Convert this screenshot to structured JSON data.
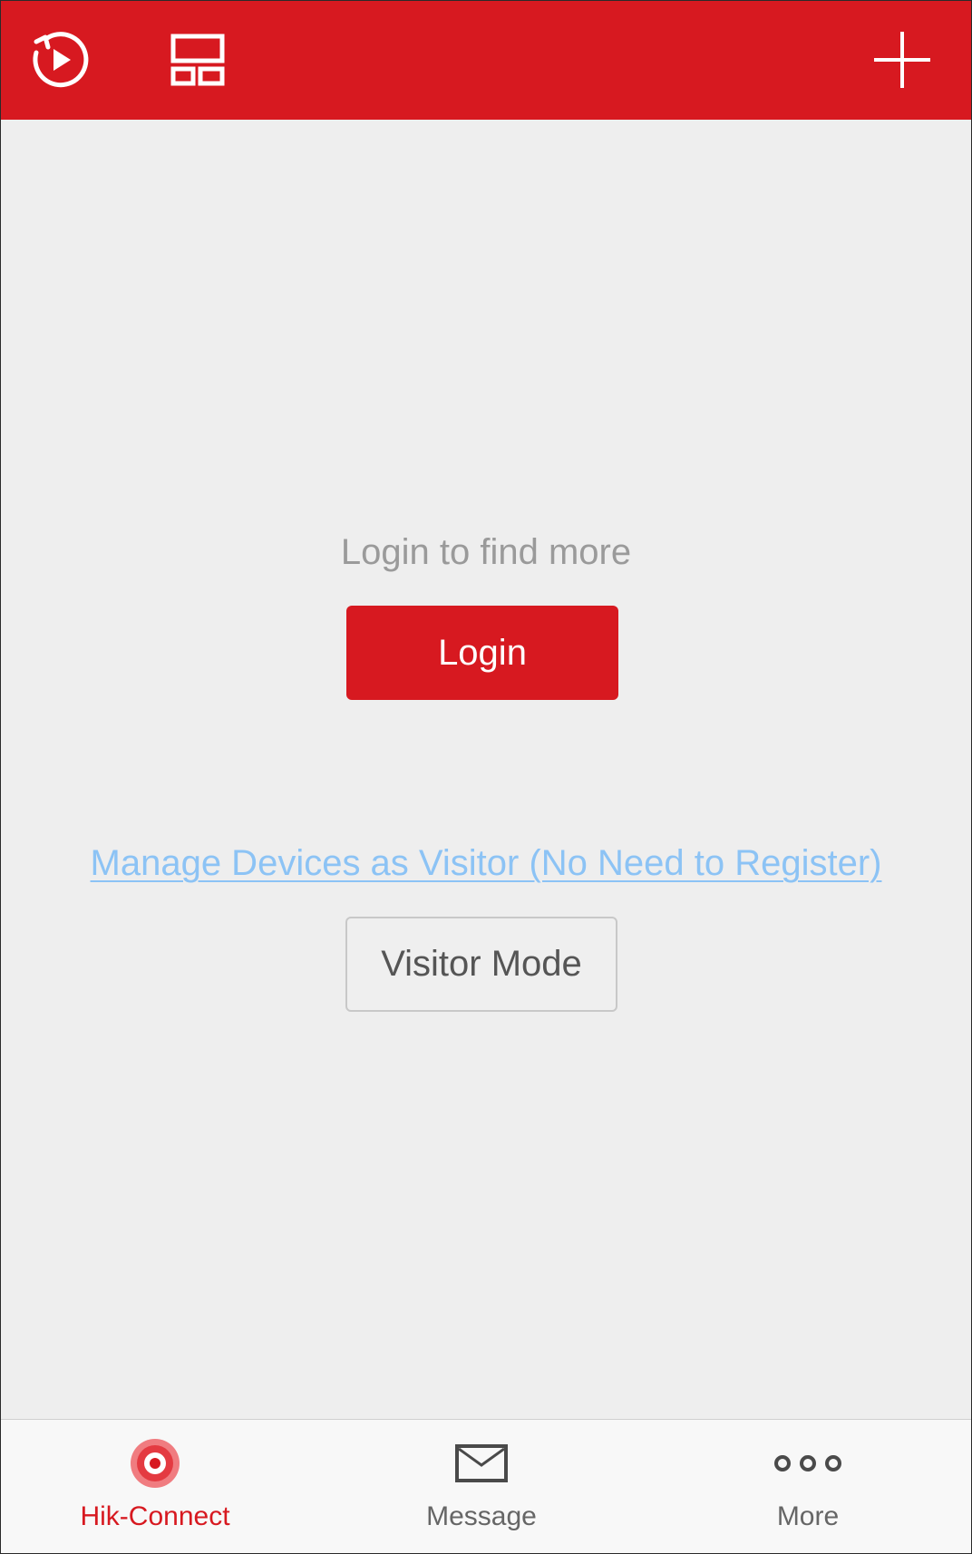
{
  "colors": {
    "brand": "#d71920",
    "background": "#eeeeee",
    "link": "#8cc3f5",
    "muted_text": "#9a9a9a"
  },
  "topbar": {
    "icons": [
      "replay-icon",
      "layout-icon",
      "add-icon"
    ]
  },
  "main": {
    "hint": "Login to find more",
    "login_label": "Login",
    "visitor_link": "Manage Devices as Visitor (No Need to Register)",
    "visitor_button": "Visitor Mode"
  },
  "tabs": [
    {
      "label": "Hik-Connect",
      "icon": "hik-connect-icon",
      "active": true
    },
    {
      "label": "Message",
      "icon": "envelope-icon",
      "active": false
    },
    {
      "label": "More",
      "icon": "more-dots-icon",
      "active": false
    }
  ]
}
